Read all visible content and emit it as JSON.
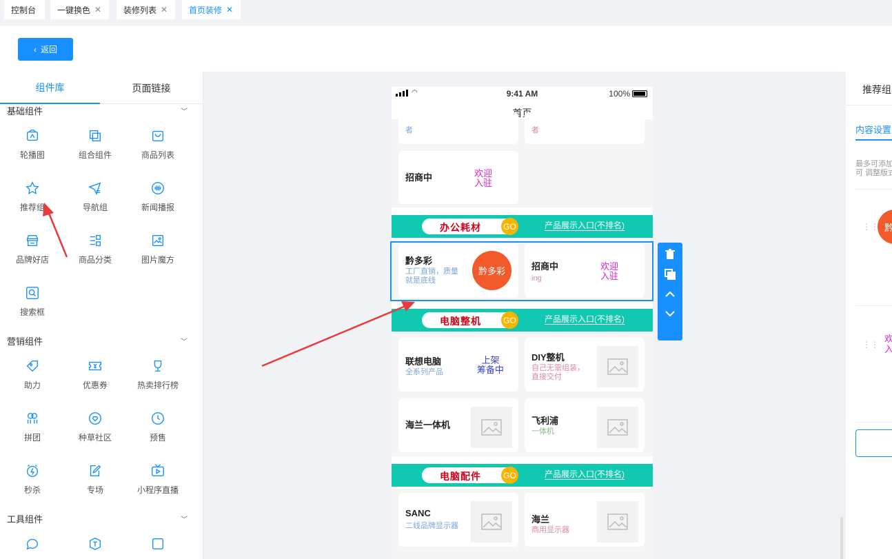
{
  "tabs": [
    {
      "label": "控制台",
      "closable": false
    },
    {
      "label": "一键换色",
      "closable": true
    },
    {
      "label": "装修列表",
      "closable": true
    },
    {
      "label": "首页装修",
      "closable": true,
      "active": true
    }
  ],
  "header": {
    "back_label": "返回"
  },
  "left": {
    "tabs": [
      "组件库",
      "页面链接"
    ],
    "sections": [
      {
        "title": "基础组件",
        "items": [
          "轮播图",
          "组合组件",
          "商品列表",
          "推荐组",
          "导航组",
          "新闻播报",
          "品牌好店",
          "商品分类",
          "图片魔方",
          "搜索框"
        ]
      },
      {
        "title": "营销组件",
        "items": [
          "助力",
          "优惠券",
          "热卖排行榜",
          "拼团",
          "种草社区",
          "预售",
          "秒杀",
          "专场",
          "小程序直播"
        ]
      },
      {
        "title": "工具组件",
        "items": [
          "",
          "",
          ""
        ]
      }
    ]
  },
  "phone": {
    "status": {
      "time": "9:41 AM",
      "battery": "100%"
    },
    "title": "首页",
    "top_partial": {
      "left_sub": "者",
      "right_sub": "者"
    },
    "zhaoshang": {
      "title": "招商中",
      "tag": "欢迎\n入驻"
    },
    "group1": {
      "banner": "办公耗材",
      "go": "GO",
      "link": "产品展示入口(不排名)",
      "cards": [
        {
          "title": "黔多彩",
          "sub": "工厂直销，质量就是底线",
          "badge": "黔多彩"
        },
        {
          "title": "招商中",
          "sub": "ing",
          "tag": "欢迎\n入驻"
        }
      ]
    },
    "group2": {
      "banner": "电脑整机",
      "go": "GO",
      "link": "产品展示入口(不排名)",
      "cards": [
        {
          "title": "联想电脑",
          "sub": "全系列产品",
          "tag": "上架\n筹备中"
        },
        {
          "title": "DIY整机",
          "sub": "自己无需组装，直接交付"
        },
        {
          "title": "海兰一体机",
          "sub": ""
        },
        {
          "title": "飞利浦",
          "sub": "一体机"
        }
      ]
    },
    "group3": {
      "banner": "电脑配件",
      "go": "GO",
      "link": "产品展示入口(不排名)",
      "cards": [
        {
          "title": "SANC",
          "sub": "二线品牌显示器"
        },
        {
          "title": "海兰",
          "sub": "商用显示器"
        }
      ]
    }
  },
  "right": {
    "title": "推荐组",
    "tab": "内容设置",
    "note": "最多可添加\n可 调整版式",
    "circle": "黔",
    "pink": "欢\n入"
  },
  "colors": {
    "accent": "#1890ff",
    "teal": "#11c8b0",
    "badge": "#f25a2c",
    "go": "#f7b500"
  }
}
